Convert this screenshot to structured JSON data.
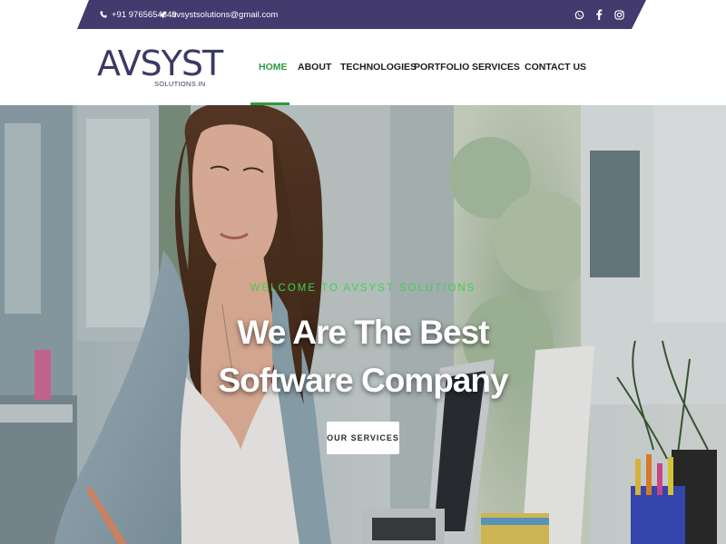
{
  "colors": {
    "topbar": "#433a6e",
    "accent_green": "#2e9a3e",
    "eyebrow_green": "#3fd14f",
    "logo": "#3b3a64"
  },
  "topbar": {
    "phone": "+91 9765654849",
    "email": "avsystsolutions@gmail.com",
    "phone_icon": "phone-icon",
    "email_icon": "paper-plane-icon",
    "social": [
      "whatsapp-icon",
      "facebook-icon",
      "instagram-icon"
    ]
  },
  "header": {
    "logo_main": "AVSYST",
    "logo_sub": "SOLUTIONS.IN",
    "nav": [
      {
        "label": "HOME",
        "active": true
      },
      {
        "label": "ABOUT",
        "active": false
      },
      {
        "label": "TECHNOLOGIES",
        "active": false
      },
      {
        "label": "PORTFOLIO",
        "active": false
      },
      {
        "label": "SERVICES",
        "active": false
      },
      {
        "label": "CONTACT US",
        "active": false
      }
    ]
  },
  "hero": {
    "eyebrow": "WELCOME TO AVSYST SOLUTIONS",
    "title": "We Are The Best Software Company",
    "button": "OUR SERVICES"
  }
}
